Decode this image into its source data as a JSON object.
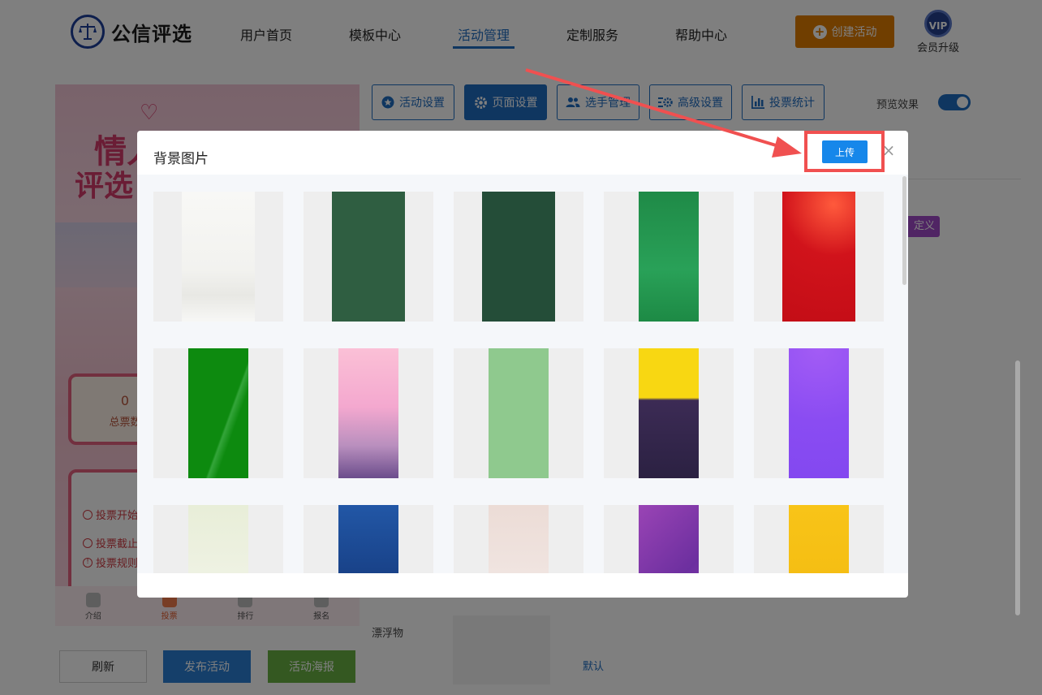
{
  "header": {
    "brand": "公信评选",
    "nav": [
      {
        "label": "用户首页",
        "active": false
      },
      {
        "label": "模板中心",
        "active": false
      },
      {
        "label": "活动管理",
        "active": true
      },
      {
        "label": "定制服务",
        "active": false
      },
      {
        "label": "帮助中心",
        "active": false
      }
    ],
    "create_button": "创建活动",
    "vip_badge": "VIP",
    "vip_label": "会员升级"
  },
  "preview": {
    "title_line1": "情人",
    "title_line2": "评选",
    "stat_value": "0",
    "stat_label": "总票数",
    "info_rows": [
      "投票开始",
      "投票截止",
      "投票规则"
    ],
    "tabs": [
      {
        "label": "介绍",
        "active": false
      },
      {
        "label": "投票",
        "active": true
      },
      {
        "label": "排行",
        "active": false
      },
      {
        "label": "报名",
        "active": false
      }
    ]
  },
  "bottom_buttons": {
    "refresh": "刷新",
    "publish": "发布活动",
    "poster": "活动海报"
  },
  "toolbar": {
    "buttons": [
      {
        "label": "活动设置",
        "icon": "star-icon",
        "active": false
      },
      {
        "label": "页面设置",
        "icon": "gear-icon",
        "active": true
      },
      {
        "label": "选手管理",
        "icon": "users-icon",
        "active": false
      },
      {
        "label": "高级设置",
        "icon": "advanced-settings-icon",
        "active": false
      },
      {
        "label": "投票统计",
        "icon": "bar-chart-icon",
        "active": false
      }
    ],
    "preview_label": "预览效果",
    "preview_on": true
  },
  "settings": {
    "custom_tag": "定义",
    "float_label": "漂浮物",
    "float_default": "默认"
  },
  "modal": {
    "title": "背景图片",
    "upload_button": "上传",
    "close_icon": "close-icon",
    "backgrounds": [
      {
        "name": "ink-landscape",
        "color": "#f7f7f5"
      },
      {
        "name": "dark-green",
        "color": "#2f5e41"
      },
      {
        "name": "deep-green",
        "color": "#244d38"
      },
      {
        "name": "bright-green",
        "color": "#23954f"
      },
      {
        "name": "red-festive",
        "color": "#d1131b"
      },
      {
        "name": "grass-green",
        "color": "#0d8a0f"
      },
      {
        "name": "pink-purple",
        "color": "#f3b6cc"
      },
      {
        "name": "mint-lotus",
        "color": "#8fc98e"
      },
      {
        "name": "yellow-night",
        "color": "#f8d712"
      },
      {
        "name": "violet",
        "color": "#8a4cf2"
      },
      {
        "name": "bamboo",
        "color": "#f1f3e6"
      },
      {
        "name": "navy-blue",
        "color": "#153e8c"
      },
      {
        "name": "blush",
        "color": "#f3ebe9"
      },
      {
        "name": "purple-geo",
        "color": "#7b39ad"
      },
      {
        "name": "golden",
        "color": "#f6c417"
      }
    ]
  },
  "colors": {
    "primary": "#1f6cc1",
    "orange": "#e07c00",
    "green": "#68b043",
    "annotation": "#f05050"
  }
}
